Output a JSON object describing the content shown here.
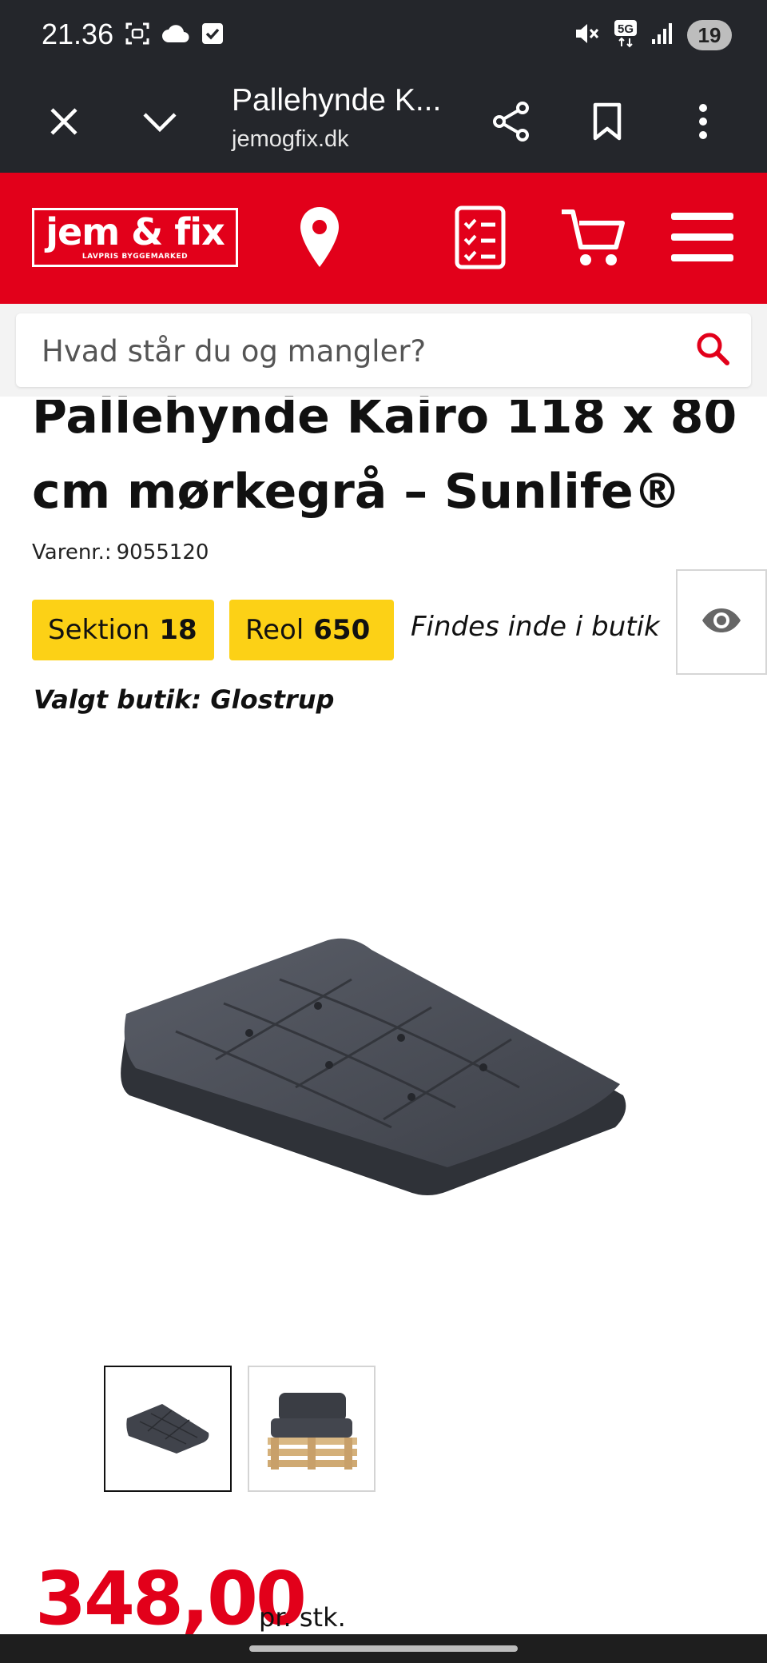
{
  "status_bar": {
    "time": "21.36",
    "battery": "19",
    "network": "5G"
  },
  "browser": {
    "title": "Pallehynde K...",
    "domain": "jemogfix.dk"
  },
  "site_header": {
    "logo_text": "jem & fix",
    "logo_tagline": "LAVPRIS BYGGEMARKED",
    "brand_color": "#e2001a"
  },
  "search": {
    "placeholder": "Hvad står du og mangler?"
  },
  "product": {
    "title": "Pallehynde Kairo 118 x 80 cm mørkegrå – Sunlife®",
    "sku_label": "Varenr.:",
    "sku": "9055120",
    "section_label": "Sektion",
    "section_value": "18",
    "shelf_label": "Reol",
    "shelf_value": "650",
    "availability": "Findes inde i butik",
    "selected_store": "Valgt butik: Glostrup",
    "price": "348,00",
    "price_unit": "pr. stk."
  },
  "colors": {
    "accent_red": "#e2001a",
    "badge_yellow": "#fcd116",
    "dark_bar": "#24262b"
  }
}
